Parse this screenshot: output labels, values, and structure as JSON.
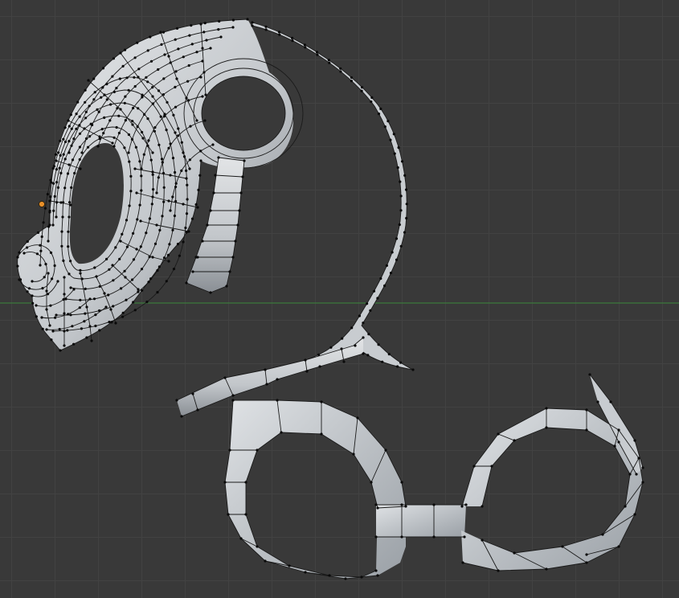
{
  "viewport": {
    "name": "3d-viewport",
    "background": "#393939",
    "grid_color": "#424242",
    "x_axis_color": "#3c7a3c",
    "mesh_color": "#bfc3c8",
    "wire_color": "#1a1a1a",
    "vertex_color": "#0a0a0a",
    "origin_color": "#e8902a"
  },
  "objects": [
    {
      "name": "head-mesh",
      "icon": "mesh-object"
    },
    {
      "name": "glasses-frame-upper",
      "icon": "mesh-object"
    },
    {
      "name": "glasses-frame-lower",
      "icon": "mesh-object"
    }
  ]
}
